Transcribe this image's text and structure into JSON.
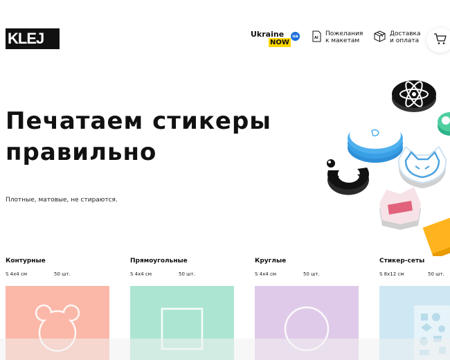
{
  "header": {
    "logo_text": "KLEJ",
    "ukraine_now": {
      "top": "Ukraine",
      "bottom": "NOW",
      "badge": "ua"
    },
    "nav": [
      {
        "line1": "Пожелания",
        "line2": "к макетам",
        "icon": "ai-file-icon"
      },
      {
        "line1": "Доставка",
        "line2": "и оплата",
        "icon": "box-icon"
      }
    ],
    "cart_icon": "cart-icon"
  },
  "hero": {
    "title_line1": "Печатаем стикеры",
    "title_line2": "правильно",
    "subtitle": "Плотные, матовые, не стираются."
  },
  "products": [
    {
      "title": "Контурные",
      "size": "S 4x4 см",
      "qty": "50 шт.",
      "color": "#fbb8a8",
      "shape": "bear-outline"
    },
    {
      "title": "Прямоугольные",
      "size": "S 4x4 см",
      "qty": "50 шт.",
      "color": "#ade5d3",
      "shape": "square"
    },
    {
      "title": "Круглые",
      "size": "S 4x4 см",
      "qty": "50 шт.",
      "color": "#dfcbe9",
      "shape": "circle"
    },
    {
      "title": "Стикер-сеты",
      "size": "S 8x12 см",
      "qty": "50 шт.",
      "color": "#cde8f3",
      "shape": "sticker-sheet"
    }
  ],
  "colors": {
    "brand": "#111111",
    "accent_yellow": "#ffd600",
    "accent_blue": "#1d6fd8"
  }
}
